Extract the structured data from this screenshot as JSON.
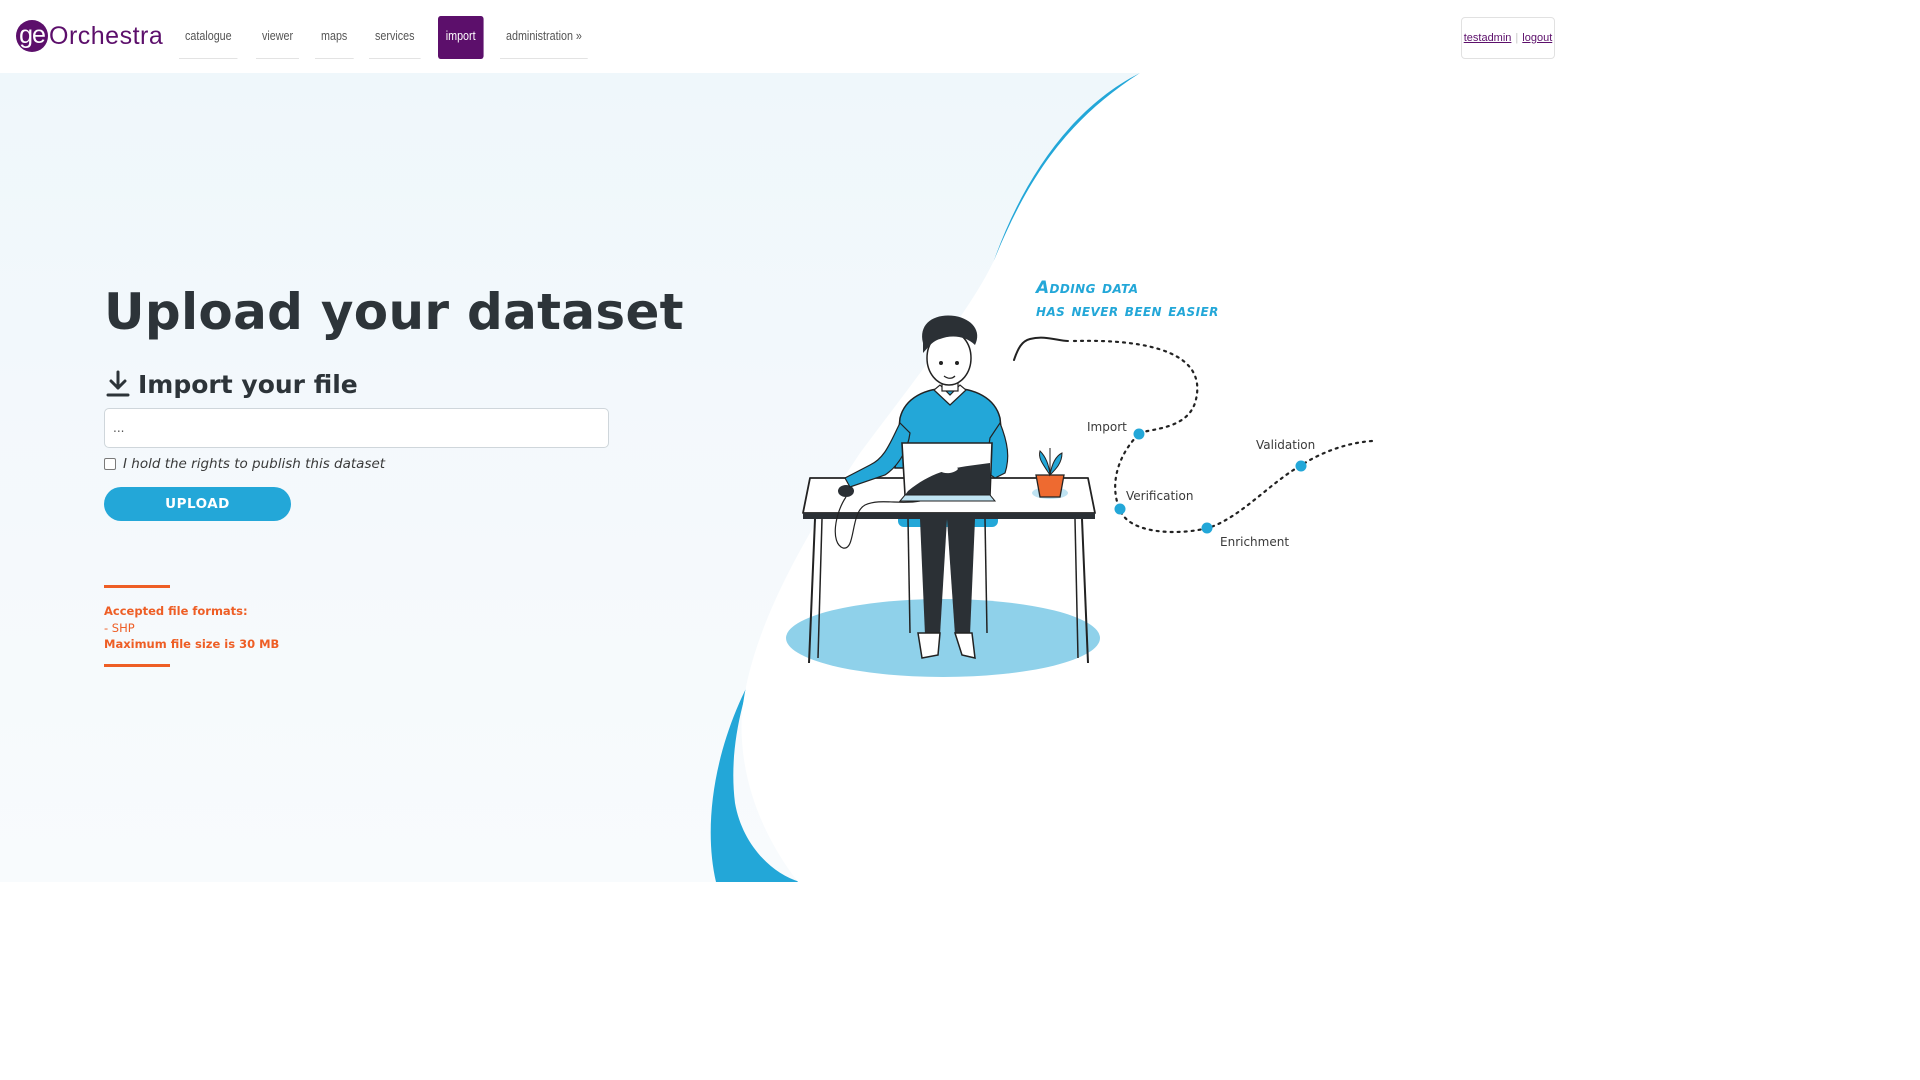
{
  "header": {
    "logo": {
      "badge": "ge",
      "text": "Orchestra"
    },
    "nav": [
      {
        "label": "catalogue",
        "active": false
      },
      {
        "label": "viewer",
        "active": false
      },
      {
        "label": "maps",
        "active": false
      },
      {
        "label": "services",
        "active": false
      },
      {
        "label": "import",
        "active": true
      },
      {
        "label": "administration »",
        "active": false
      }
    ],
    "user": {
      "username": "testadmin",
      "logout_label": "logout"
    }
  },
  "main": {
    "title": "Upload your dataset",
    "import_heading": "Import your file",
    "file_input_value": "...",
    "rights_label": "I hold the rights to publish this dataset",
    "rights_checked": false,
    "upload_button": "UPLOAD",
    "info": {
      "formats_title": "Accepted file formats:",
      "formats": [
        "- SHP"
      ],
      "max_size": "Maximum file size is 30 MB"
    }
  },
  "illustration": {
    "tagline_line1": "Adding data",
    "tagline_line2": "has never been easier",
    "steps": [
      "Import",
      "Verification",
      "Enrichment",
      "Validation"
    ]
  },
  "colors": {
    "brand": "#5c0f6b",
    "accent": "#23a7d8",
    "warning": "#ee5e25",
    "title": "#2d3439"
  }
}
